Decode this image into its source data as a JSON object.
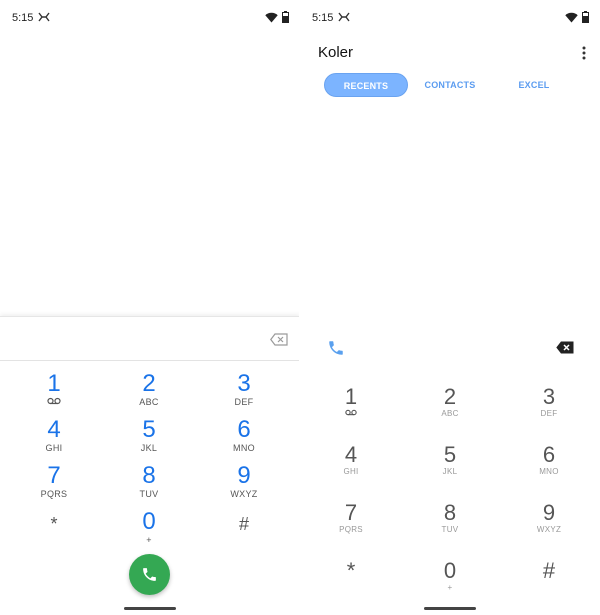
{
  "left": {
    "status": {
      "time": "5:15"
    },
    "keys": [
      {
        "num": "1",
        "sub": "voicemail"
      },
      {
        "num": "2",
        "sub": "ABC"
      },
      {
        "num": "3",
        "sub": "DEF"
      },
      {
        "num": "4",
        "sub": "GHI"
      },
      {
        "num": "5",
        "sub": "JKL"
      },
      {
        "num": "6",
        "sub": "MNO"
      },
      {
        "num": "7",
        "sub": "PQRS"
      },
      {
        "num": "8",
        "sub": "TUV"
      },
      {
        "num": "9",
        "sub": "WXYZ"
      },
      {
        "num": "*",
        "sub": ""
      },
      {
        "num": "0",
        "sub": "+"
      },
      {
        "num": "#",
        "sub": ""
      }
    ],
    "accent": "#1a73e8",
    "call_color": "#34a853"
  },
  "right": {
    "status": {
      "time": "5:15"
    },
    "app_title": "Koler",
    "tabs": [
      {
        "label": "RECENTS",
        "active": true
      },
      {
        "label": "CONTACTS",
        "active": false
      },
      {
        "label": "EXCEL",
        "active": false
      }
    ],
    "keys": [
      {
        "num": "1",
        "sub": "voicemail"
      },
      {
        "num": "2",
        "sub": "ABC"
      },
      {
        "num": "3",
        "sub": "DEF"
      },
      {
        "num": "4",
        "sub": "GHI"
      },
      {
        "num": "5",
        "sub": "JKL"
      },
      {
        "num": "6",
        "sub": "MNO"
      },
      {
        "num": "7",
        "sub": "PQRS"
      },
      {
        "num": "8",
        "sub": "TUV"
      },
      {
        "num": "9",
        "sub": "WXYZ"
      },
      {
        "num": "*",
        "sub": ""
      },
      {
        "num": "0",
        "sub": "+"
      },
      {
        "num": "#",
        "sub": ""
      }
    ],
    "accent": "#7cb4ff"
  },
  "icons": [
    "notification-icon",
    "wifi-icon",
    "battery-icon",
    "backspace-icon",
    "call-icon",
    "voicemail-icon",
    "more-options-icon"
  ]
}
